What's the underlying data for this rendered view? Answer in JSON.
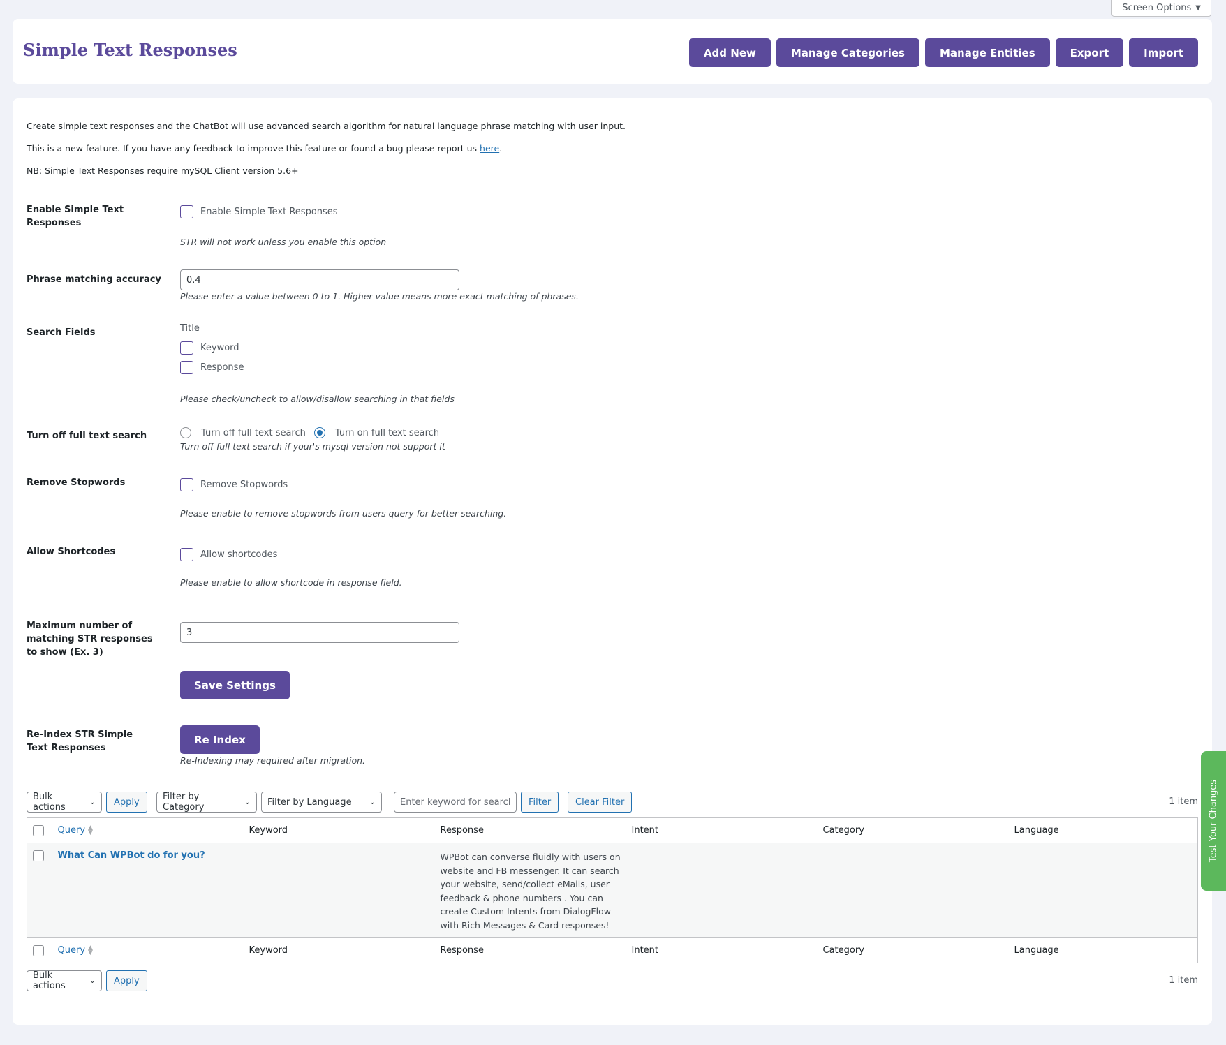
{
  "screen_options": {
    "label": "Screen Options",
    "caret": "▼"
  },
  "header": {
    "title": "Simple Text Responses",
    "buttons": {
      "add_new": "Add New",
      "manage_categories": "Manage Categories",
      "manage_entities": "Manage Entities",
      "export": "Export",
      "import": "Import"
    }
  },
  "intro": {
    "line1": "Create simple text responses and the ChatBot will use advanced search algorithm for natural language phrase matching with user input.",
    "line2_text": "This is a new feature. If you have any feedback to improve this feature or found a bug please report us ",
    "line2_link": "here",
    "line2_end": ".",
    "line3": "NB: Simple Text Responses require mySQL Client version 5.6+"
  },
  "settings": {
    "enable": {
      "label": "Enable Simple Text Responses",
      "checkbox_label": "Enable Simple Text Responses",
      "checked": false,
      "desc": "STR will not work unless you enable this option"
    },
    "accuracy": {
      "label": "Phrase matching accuracy",
      "value": "0.4",
      "desc": "Please enter a value between 0 to 1. Higher value means more exact matching of phrases."
    },
    "search_fields": {
      "label": "Search Fields",
      "static_item": "Title",
      "keyword_label": "Keyword",
      "response_label": "Response",
      "desc": "Please check/uncheck to allow/disallow searching in that fields"
    },
    "full_text": {
      "label": "Turn off full text search",
      "option_off": "Turn off full text search",
      "option_on": "Turn on full text search",
      "selected": "on",
      "desc": "Turn off full text search if your's mysql version not support it"
    },
    "stopwords": {
      "label": "Remove Stopwords",
      "checkbox_label": "Remove Stopwords",
      "desc": "Please enable to remove stopwords from users query for better searching."
    },
    "shortcodes": {
      "label": "Allow Shortcodes",
      "checkbox_label": "Allow shortcodes",
      "desc": "Please enable to allow shortcode in response field."
    },
    "max_responses": {
      "label": "Maximum number of matching STR responses to show (Ex. 3)",
      "value": "3"
    },
    "save_label": "Save Settings",
    "reindex": {
      "label": "Re-Index STR Simple Text Responses",
      "button": "Re Index",
      "desc": "Re-Indexing may required after migration."
    }
  },
  "tablenav": {
    "bulk_actions": "Bulk actions",
    "apply": "Apply",
    "filter_category": "Filter by Category",
    "filter_language": "Filter by Language",
    "search_placeholder": "Enter keyword for search",
    "filter_btn": "Filter",
    "clear_filter": "Clear Filter",
    "items_count": "1 item"
  },
  "table": {
    "columns": {
      "query": "Query",
      "keyword": "Keyword",
      "response": "Response",
      "intent": "Intent",
      "category": "Category",
      "language": "Language"
    },
    "rows": [
      {
        "query": "What Can WPBot do for you?",
        "keyword": "",
        "response": "WPBot can converse fluidly with users on website and FB messenger. It can search your website, send/collect eMails, user feedback & phone numbers . You can create Custom Intents from DialogFlow with Rich Messages & Card responses!",
        "intent": "",
        "category": "",
        "language": ""
      }
    ]
  },
  "side_tab": {
    "label": "Test Your Changes",
    "color": "#5cb85c"
  },
  "colors": {
    "accent": "#5b4a9b",
    "link": "#2271b1",
    "background": "#f0f2f8"
  }
}
